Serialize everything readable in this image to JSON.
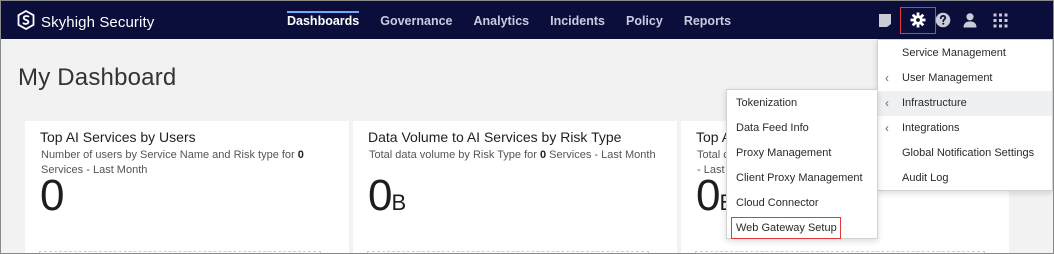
{
  "app": {
    "name": "Skyhigh Security"
  },
  "nav": {
    "items": [
      {
        "label": "Dashboards",
        "active": true
      },
      {
        "label": "Governance",
        "active": false
      },
      {
        "label": "Analytics",
        "active": false
      },
      {
        "label": "Incidents",
        "active": false
      },
      {
        "label": "Policy",
        "active": false
      },
      {
        "label": "Reports",
        "active": false
      }
    ]
  },
  "top_icons": [
    "notification-icon",
    "gear-icon",
    "help-icon",
    "user-icon",
    "app-grid-icon"
  ],
  "colors": {
    "topbar": "#0b0e3b",
    "active_underline": "#6fa8ff",
    "highlight_border": "#e23a3a"
  },
  "page": {
    "title": "My Dashboard"
  },
  "cards": [
    {
      "title": "Top AI Services by Users",
      "sub_prefix": "Number of users by Service Name and Risk type for ",
      "sub_count": "0",
      "sub_suffix": " Services - Last Month",
      "value": "0",
      "unit": ""
    },
    {
      "title": "Data Volume to AI Services by Risk Type",
      "sub_prefix": "Total data volume by Risk Type for ",
      "sub_count": "0",
      "sub_suffix": " Services - Last Month",
      "value": "0",
      "unit": "B"
    },
    {
      "title": "Top A",
      "sub_line1": "Total c",
      "sub_line2": "- Last M",
      "value": "0",
      "unit": "B"
    }
  ],
  "settings_menu": {
    "items": [
      {
        "label": "Service Management",
        "has_submenu": false
      },
      {
        "label": "User Management",
        "has_submenu": true
      },
      {
        "label": "Infrastructure",
        "has_submenu": true,
        "highlighted": true
      },
      {
        "label": "Integrations",
        "has_submenu": true
      },
      {
        "label": "Global Notification Settings",
        "has_submenu": false
      },
      {
        "label": "Audit Log",
        "has_submenu": false
      }
    ]
  },
  "infrastructure_submenu": {
    "items": [
      {
        "label": "Tokenization"
      },
      {
        "label": "Data Feed Info"
      },
      {
        "label": "Proxy Management"
      },
      {
        "label": "Client Proxy Management"
      },
      {
        "label": "Cloud Connector"
      },
      {
        "label": "Web Gateway Setup",
        "outlined": true
      }
    ]
  }
}
